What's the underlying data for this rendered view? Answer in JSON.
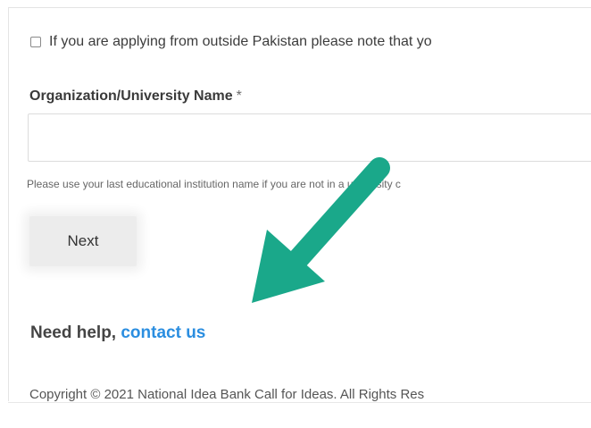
{
  "form": {
    "outside_pakistan_notice": "If you are applying from outside Pakistan please note that yo",
    "org_label": "Organization/University Name",
    "required_marker": "*",
    "org_input_value": "",
    "help_text": "Please use your last educational institution name if you are not in a university c",
    "next_label": "Next"
  },
  "help": {
    "prefix": "Need help, ",
    "link": "contact us"
  },
  "footer": {
    "copyright": "Copyright © 2021 National Idea Bank Call for Ideas. All Rights Res"
  },
  "annotation": {
    "icon": "annotation-arrow-icon",
    "color": "#1aa88a"
  }
}
